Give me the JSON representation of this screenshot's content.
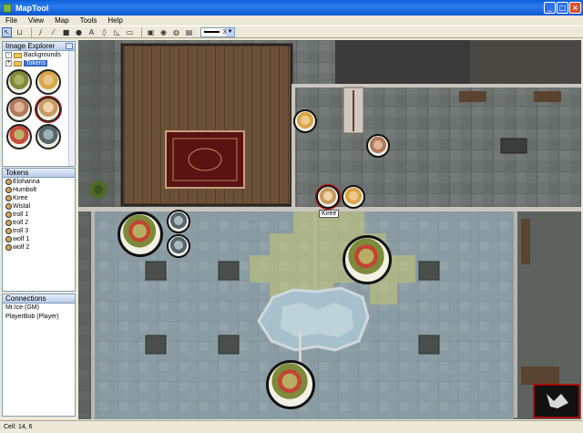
{
  "window": {
    "title": "MapTool"
  },
  "menu": [
    "File",
    "View",
    "Map",
    "Tools",
    "Help"
  ],
  "toolbar": {
    "line_width": "3"
  },
  "image_explorer": {
    "title": "Image Explorer",
    "tree": [
      {
        "label": "Backgrounds",
        "expanded": true
      },
      {
        "label": "Tokens",
        "expanded": false,
        "selected": true
      }
    ]
  },
  "tokens_panel": {
    "title": "Tokens",
    "items": [
      "Elohanna",
      "Humbolt",
      "Kiree",
      "Wistal",
      "troll 1",
      "troll 2",
      "troll 3",
      "wolf 1",
      "wolf 2"
    ]
  },
  "connections": {
    "title": "Connections",
    "items": [
      "Mr.Ice (GM)",
      "PlayerBob (Player)"
    ]
  },
  "map": {
    "hover_label": "Kiree"
  },
  "status": {
    "cell": "Cell: 14, 6"
  },
  "colors": {
    "title_bar": "#0b56d0",
    "highlight": "#316ac5",
    "stone": "#6a6f6c",
    "wood": "#6b5139"
  }
}
